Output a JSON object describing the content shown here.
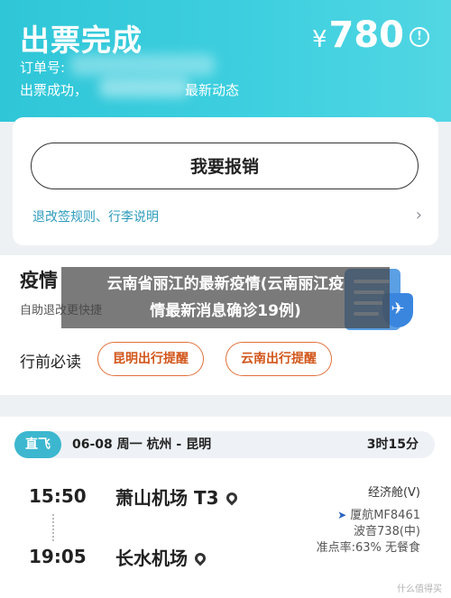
{
  "header": {
    "title": "出票完成",
    "price_currency": "¥",
    "price_value": "780",
    "order_label": "订单号:",
    "status_text": "出票成功，",
    "status_tail": "最新动态"
  },
  "reimburse": {
    "button_label": "我要报销",
    "rules_link": "退改签规则、行李说明"
  },
  "policy": {
    "title": "疫情",
    "subtitle": "自助退改更快捷",
    "must_read_label": "行前必读",
    "tags": [
      "昆明出行提醒",
      "云南出行提醒"
    ]
  },
  "overlay": {
    "line1": "云南省丽江的最新疫情(云南丽江疫",
    "line2": "情最新消息确诊19例)"
  },
  "flight": {
    "direct_label": "直飞",
    "route": "06-08  周一  杭州 - 昆明",
    "duration": "3时15分",
    "dep_time": "15:50",
    "dep_airport": "萧山机场 T3",
    "arr_time": "19:05",
    "arr_airport": "长水机场",
    "cabin": "经济舱(V)",
    "airline": "厦航MF8461",
    "aircraft": "波音738(中)",
    "punctuality": "准点率:63%  无餐食"
  },
  "watermark": "什么值得买"
}
